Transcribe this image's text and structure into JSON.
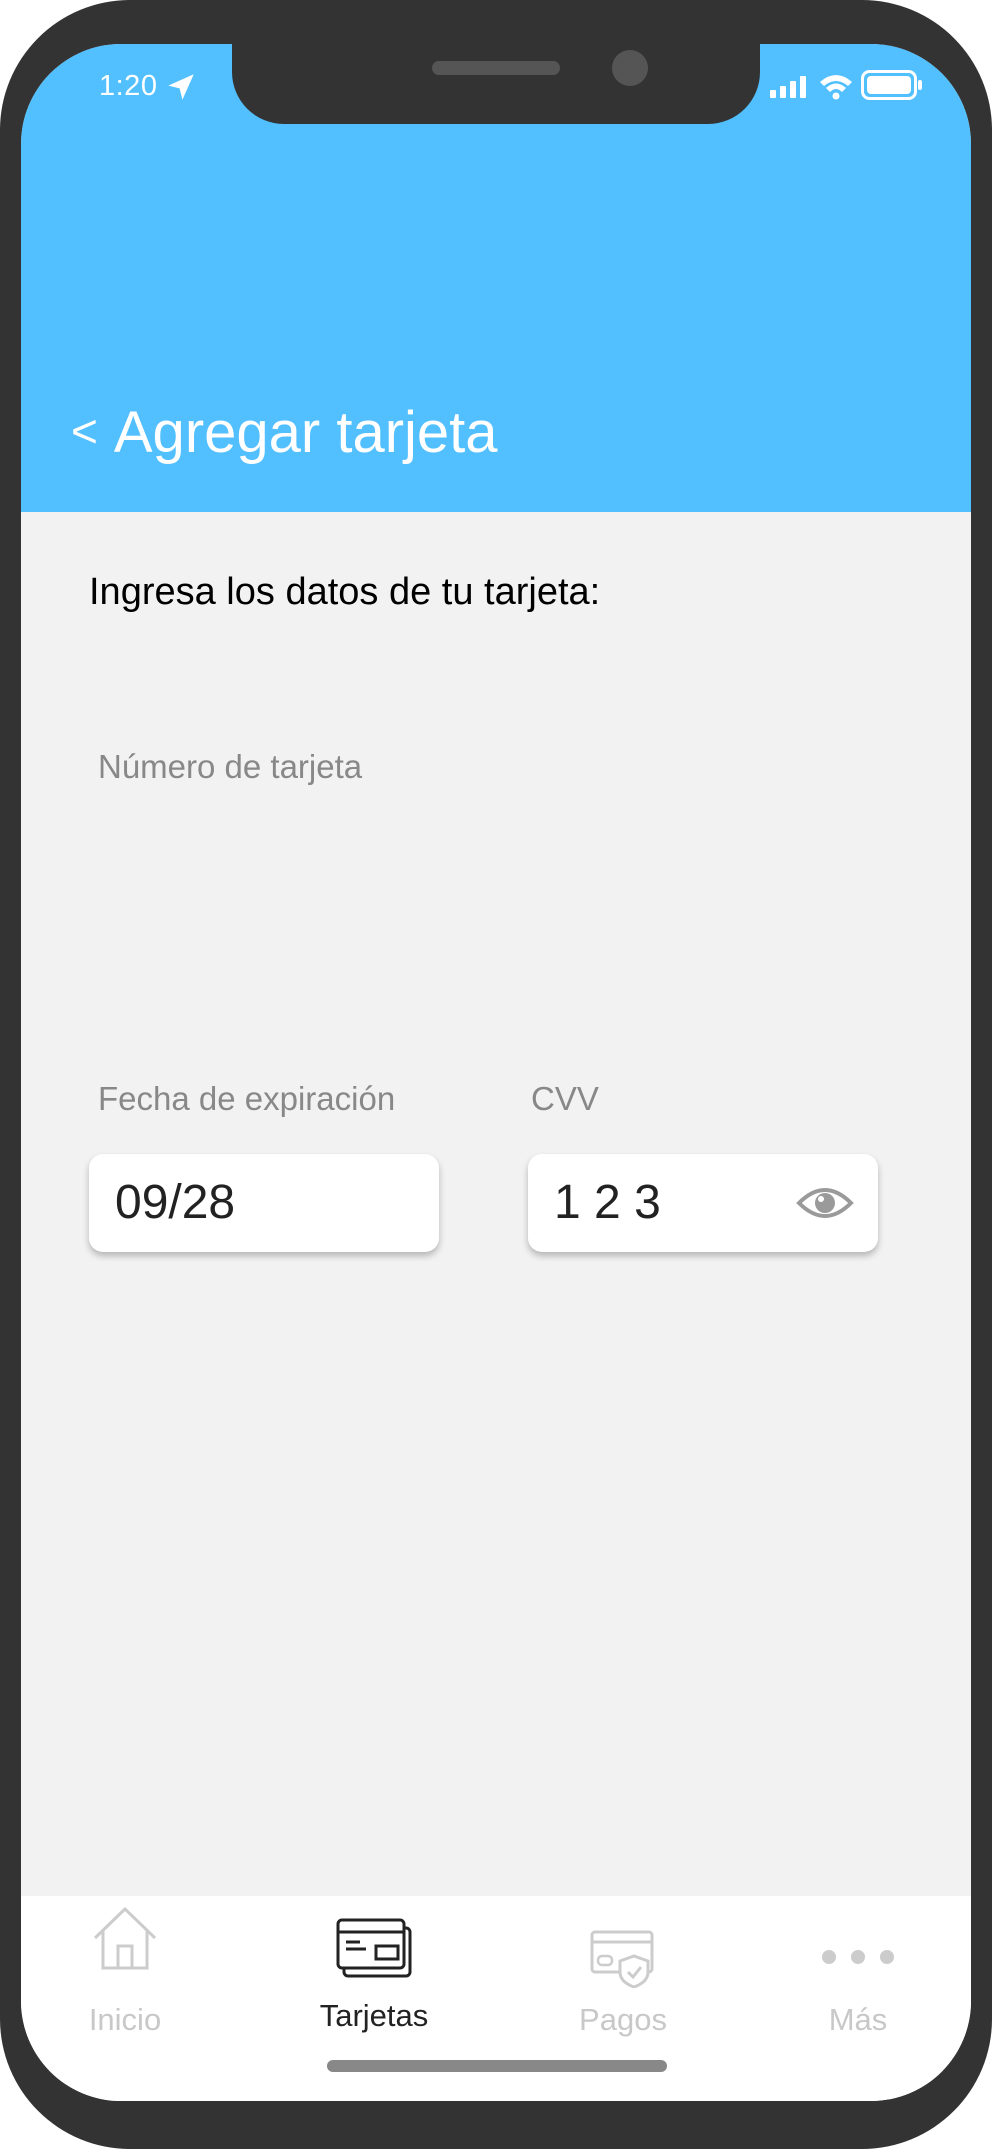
{
  "status_bar": {
    "time": "1:20"
  },
  "header": {
    "back_glyph": "<",
    "title": "Agregar tarjeta",
    "background_color": "#52bfff"
  },
  "form": {
    "heading": "Ingresa los datos de tu tarjeta:",
    "card_number": {
      "label": "Número de tarjeta"
    },
    "expiration": {
      "label": "Fecha de expiración",
      "value": "09/28"
    },
    "cvv": {
      "label": "CVV",
      "value": "1 2 3",
      "toggle_icon": "eye-icon"
    }
  },
  "bottom_nav": {
    "items": [
      {
        "label": "Inicio",
        "icon": "home-icon",
        "active": false
      },
      {
        "label": "Tarjetas",
        "icon": "cards-icon",
        "active": true
      },
      {
        "label": "Pagos",
        "icon": "secure-payment-icon",
        "active": false
      },
      {
        "label": "Más",
        "icon": "more-icon",
        "active": false
      }
    ]
  }
}
